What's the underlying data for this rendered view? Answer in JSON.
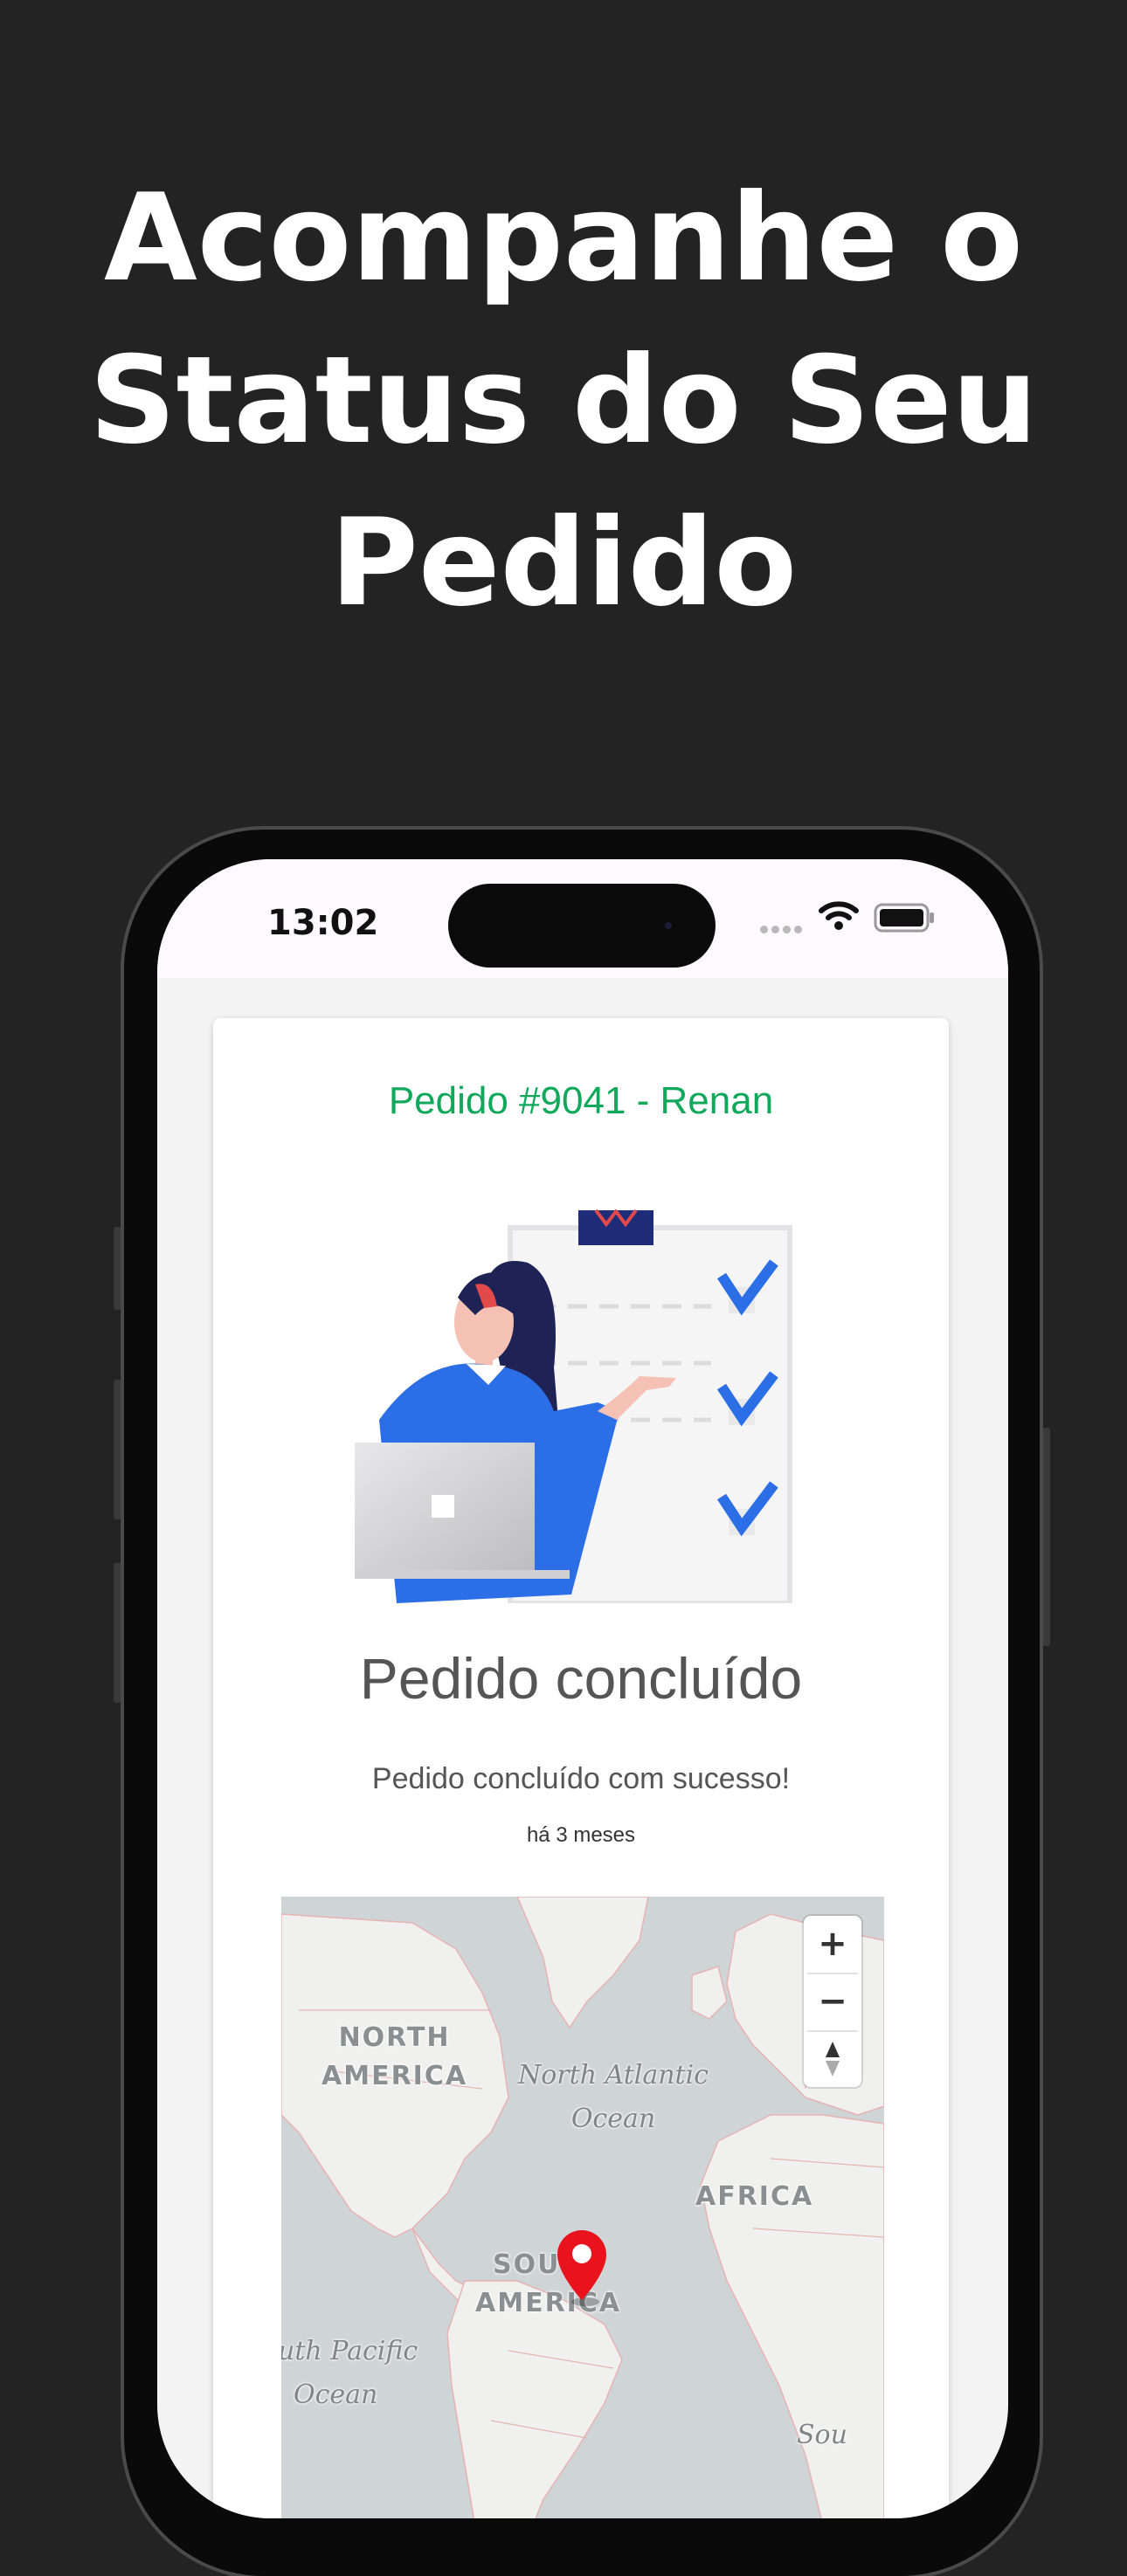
{
  "headline": [
    "Acompanhe o",
    "Status do Seu",
    "Pedido"
  ],
  "status_bar": {
    "time": "13:02"
  },
  "order": {
    "title": "Pedido #9041 - Renan",
    "status_title": "Pedido concluído",
    "status_description": "Pedido concluído com sucesso!",
    "status_time": "há 3 meses"
  },
  "map": {
    "zoom_in": "+",
    "zoom_out": "−",
    "labels": {
      "north_america": [
        "NORTH",
        "AMERICA"
      ],
      "south_america": [
        "SOUTH",
        "AMERICA"
      ],
      "africa": "AFRICA",
      "north_atlantic": [
        "North Atlantic",
        "Ocean"
      ],
      "south_pacific": [
        "uth Pacific",
        "Ocean"
      ],
      "partial_south": "Sou"
    }
  },
  "colors": {
    "background": "#232323",
    "order_title": "#10a85a",
    "checkmark": "#2b6ee6",
    "pin": "#e8131c"
  }
}
